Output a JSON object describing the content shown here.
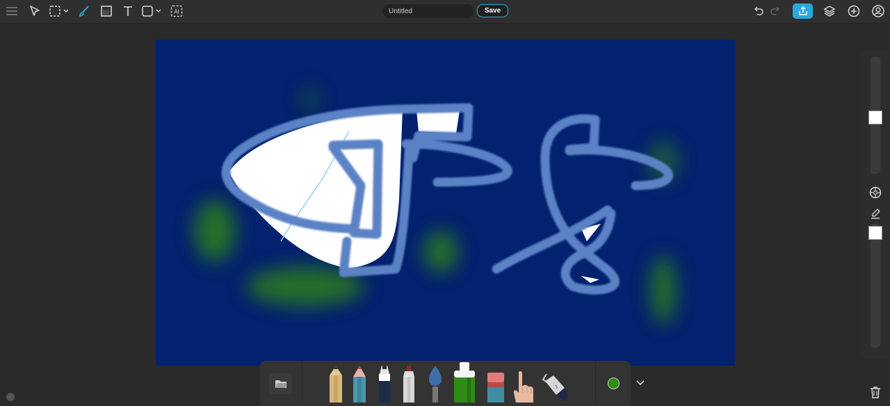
{
  "document": {
    "title_value": "Untitled",
    "save_label": "Save"
  },
  "toolbar": {
    "left_tools": [
      "menu-icon",
      "select-arrow-icon",
      "marquee-select-icon",
      "brush-icon",
      "fill-pattern-icon",
      "text-icon",
      "shape-icon",
      "ai-icon"
    ],
    "ai_label": "AI",
    "right_tools": [
      "undo-icon",
      "redo-icon",
      "share-icon",
      "layers-icon",
      "add-icon",
      "account-icon"
    ]
  },
  "brushes": [
    "pencil",
    "colored-pencil",
    "marker",
    "paint-marker",
    "watercolor-brush",
    "spray-can",
    "eraser",
    "smudge-finger",
    "bucket-fill"
  ],
  "current_color": "#2e8c16",
  "colors": {
    "accent": "#29a9d9",
    "canvas_bg": "#02216f",
    "stroke_blue": "#5b82c6",
    "fill_white": "#ffffff",
    "green_glow": "#2e8c16"
  }
}
